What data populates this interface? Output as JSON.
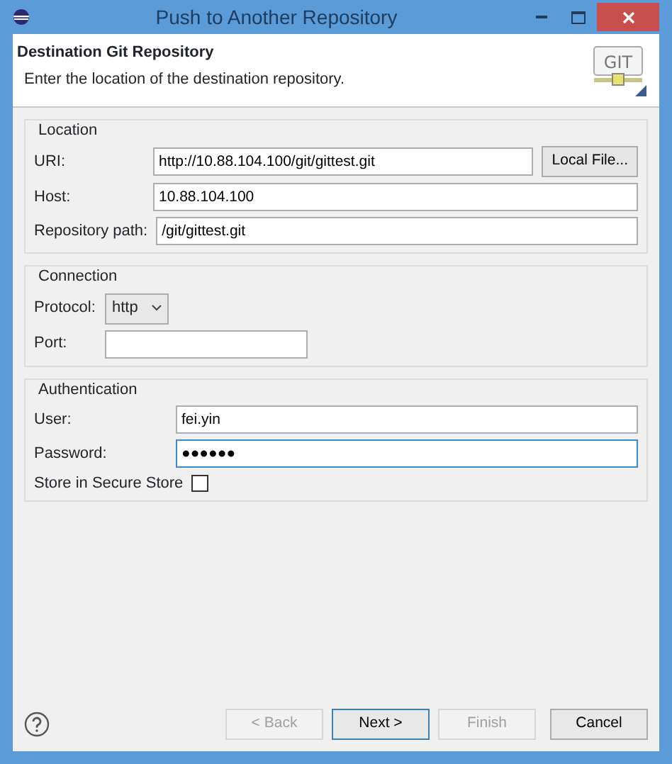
{
  "window": {
    "title": "Push to Another Repository"
  },
  "header": {
    "title": "Destination Git Repository",
    "description": "Enter the location of the destination repository.",
    "logo_text": "GIT"
  },
  "groups": [
    {
      "title": "Location",
      "fields": [
        {
          "kind": "text",
          "label": "URI:",
          "value": "http://10.88.104.100/git/gittest.git",
          "button": "Local File...",
          "focused": false
        },
        {
          "kind": "text",
          "label": "Host:",
          "value": "10.88.104.100",
          "focused": false
        },
        {
          "kind": "text",
          "label": "Repository path:",
          "value": "/git/gittest.git",
          "focused": false
        }
      ]
    },
    {
      "title": "Connection",
      "fields": [
        {
          "kind": "select",
          "label": "Protocol:",
          "value": "http"
        },
        {
          "kind": "short",
          "label": "Port:",
          "focused": false
        }
      ]
    },
    {
      "title": "Authentication",
      "fields": [
        {
          "kind": "text",
          "label": "User:",
          "value": "fei.yin",
          "focused": false
        },
        {
          "kind": "text",
          "label": "Password:",
          "value": "●●●●●●",
          "focused": true
        },
        {
          "kind": "checkbox",
          "label": "Store in Secure Store",
          "checked": false
        }
      ]
    }
  ],
  "buttons": [
    {
      "label": "< Back",
      "disabled": true,
      "default": false
    },
    {
      "label": "Next >",
      "disabled": false,
      "default": true
    },
    {
      "label": "Finish",
      "disabled": true,
      "default": false
    },
    {
      "label": "Cancel",
      "disabled": false,
      "default": false
    }
  ]
}
